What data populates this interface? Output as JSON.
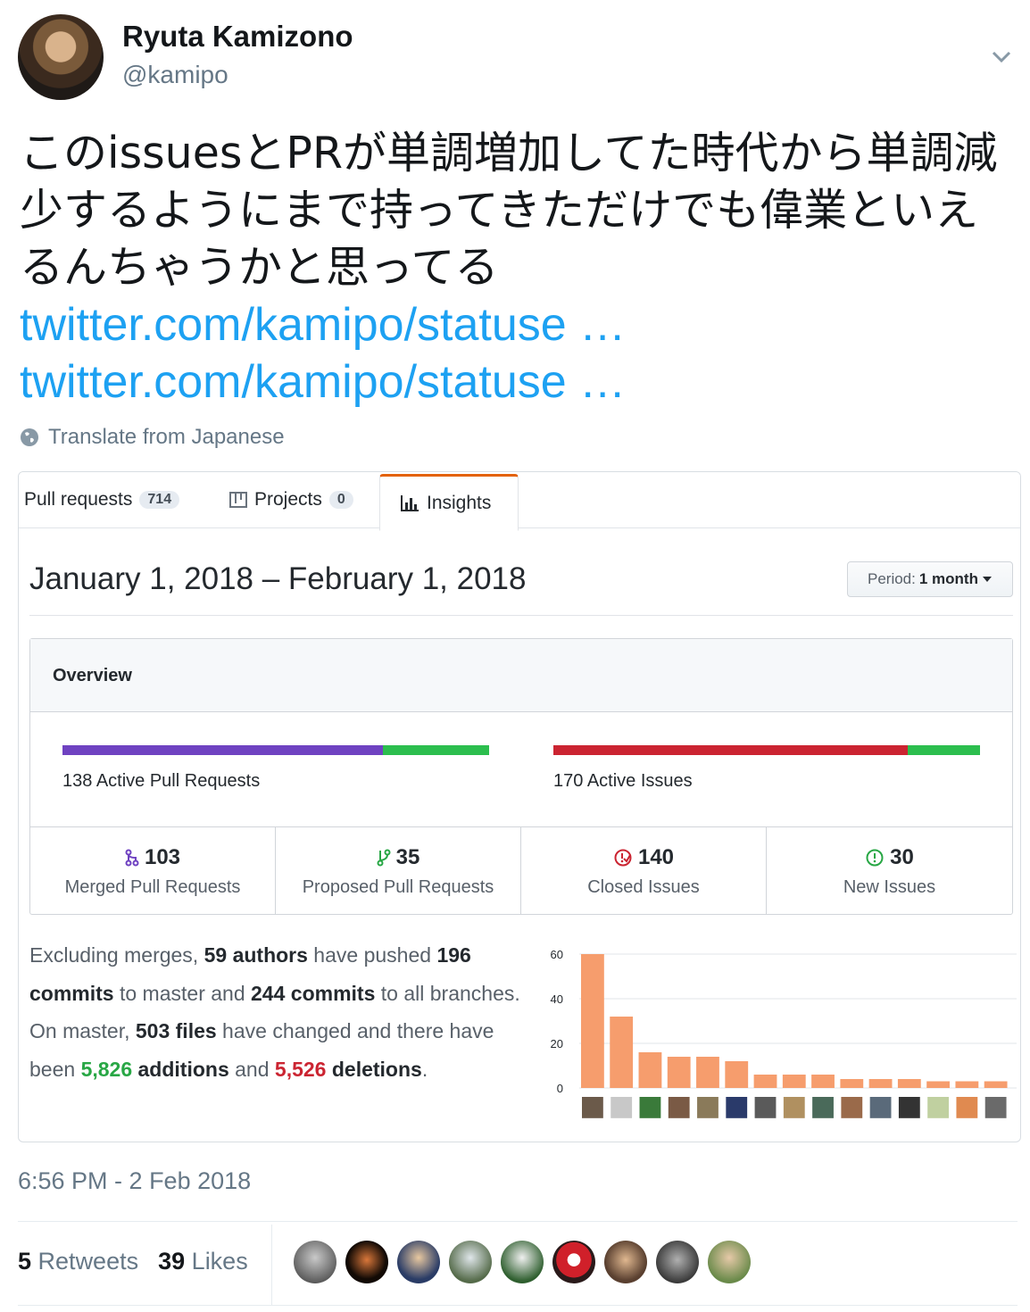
{
  "tweet": {
    "name": "Ryuta Kamizono",
    "handle": "@kamipo",
    "text": "このissuesとPRが単調増加してた時代から単調減少するようにまで持ってきただけでも偉業といえるんちゃうかと思ってる",
    "links": [
      "twitter.com/kamipo/statuse …",
      "twitter.com/kamipo/statuse …"
    ],
    "translate_label": "Translate from Japanese",
    "timestamp": "6:56 PM - 2 Feb 2018",
    "retweets_count": "5",
    "retweets_label": "Retweets",
    "likes_count": "39",
    "likes_label": "Likes",
    "accent_color": "#1da1f2"
  },
  "github": {
    "tabs": [
      {
        "label": "Pull requests",
        "count": "714"
      },
      {
        "label": "Projects",
        "count": "0"
      },
      {
        "label": "Insights",
        "count": null,
        "active": true
      }
    ],
    "date_range": "January 1, 2018 – February 1, 2018",
    "period_prefix": "Period:",
    "period_value": "1 month",
    "overview_title": "Overview",
    "pr_bar_label": "138 Active Pull Requests",
    "pr_merged_fraction": 0.75,
    "issues_bar_label": "170 Active Issues",
    "issues_closed_fraction": 0.83,
    "stats": [
      {
        "num": "103",
        "label": "Merged Pull Requests",
        "icon": "merge-icon",
        "color": "#6f42c1"
      },
      {
        "num": "35",
        "label": "Proposed Pull Requests",
        "icon": "branch-icon",
        "color": "#28a745"
      },
      {
        "num": "140",
        "label": "Closed Issues",
        "icon": "closed-issue-icon",
        "color": "#cb2431"
      },
      {
        "num": "30",
        "label": "New Issues",
        "icon": "issue-opened-icon",
        "color": "#28a745"
      }
    ],
    "summary": {
      "p1": "Excluding merges, ",
      "authors": "59 authors",
      "p2": " have pushed ",
      "commits_master": "196 commits",
      "p3": " to master and ",
      "commits_all": "244 commits",
      "p4": " to all branches. On master, ",
      "files": "503 files",
      "p5": " have changed and there have been ",
      "additions_num": "5,826",
      "additions_word": " additions",
      "p6": " and ",
      "deletions_num": "5,526",
      "deletions_word": " deletions",
      "p7": "."
    }
  },
  "chart_data": {
    "type": "bar",
    "yticks": [
      "60",
      "40",
      "20",
      "0"
    ],
    "ylim": [
      0,
      60
    ],
    "values": [
      60,
      32,
      16,
      14,
      14,
      12,
      6,
      6,
      6,
      4,
      4,
      4,
      3,
      3,
      3
    ],
    "bar_color": "#f69d6d"
  }
}
